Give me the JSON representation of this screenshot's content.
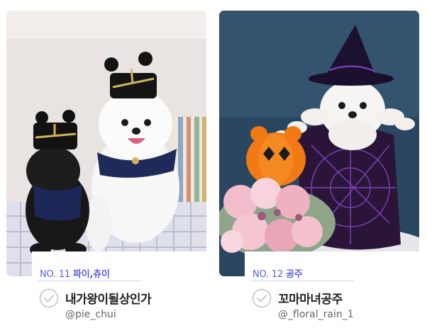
{
  "cards": [
    {
      "number": "NO. 11",
      "pet_name": "파이,츄이",
      "title": "내가왕이될상인가",
      "handle": "@pie_chui",
      "photo": "two-dogs-wearing-black-hats-and-navy-capes"
    },
    {
      "number": "NO. 12",
      "pet_name": "공주",
      "title": "꼬마마녀공주",
      "handle": "@_floral_rain_1",
      "photo": "dog-in-witch-hat-with-pumpkin-and-roses"
    }
  ],
  "icons": {
    "check": "check-circle-icon"
  },
  "colors": {
    "accent": "#5a5fe0",
    "title": "#222222",
    "handle": "#666666",
    "check": "#c4c4c4"
  }
}
